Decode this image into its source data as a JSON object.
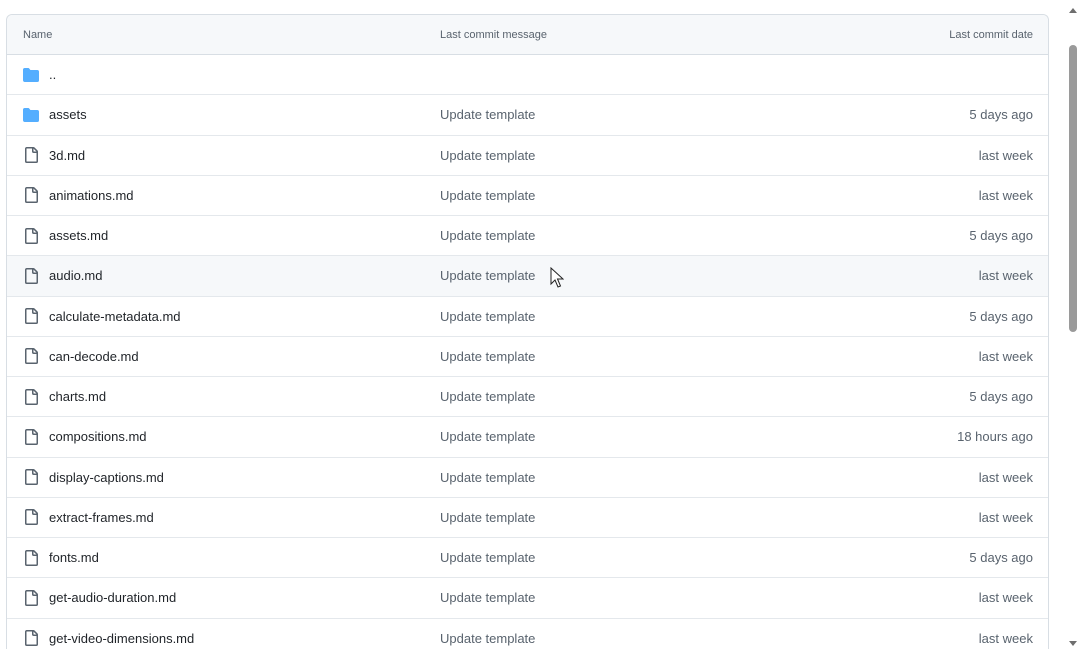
{
  "table": {
    "header": {
      "name": "Name",
      "message": "Last commit message",
      "date": "Last commit date"
    },
    "rows": [
      {
        "name": "..",
        "type": "folder",
        "message": "",
        "date": ""
      },
      {
        "name": "assets",
        "type": "folder",
        "message": "Update template",
        "date": "5 days ago"
      },
      {
        "name": "3d.md",
        "type": "file",
        "message": "Update template",
        "date": "last week"
      },
      {
        "name": "animations.md",
        "type": "file",
        "message": "Update template",
        "date": "last week"
      },
      {
        "name": "assets.md",
        "type": "file",
        "message": "Update template",
        "date": "5 days ago"
      },
      {
        "name": "audio.md",
        "type": "file",
        "message": "Update template",
        "date": "last week"
      },
      {
        "name": "calculate-metadata.md",
        "type": "file",
        "message": "Update template",
        "date": "5 days ago"
      },
      {
        "name": "can-decode.md",
        "type": "file",
        "message": "Update template",
        "date": "last week"
      },
      {
        "name": "charts.md",
        "type": "file",
        "message": "Update template",
        "date": "5 days ago"
      },
      {
        "name": "compositions.md",
        "type": "file",
        "message": "Update template",
        "date": "18 hours ago"
      },
      {
        "name": "display-captions.md",
        "type": "file",
        "message": "Update template",
        "date": "last week"
      },
      {
        "name": "extract-frames.md",
        "type": "file",
        "message": "Update template",
        "date": "last week"
      },
      {
        "name": "fonts.md",
        "type": "file",
        "message": "Update template",
        "date": "5 days ago"
      },
      {
        "name": "get-audio-duration.md",
        "type": "file",
        "message": "Update template",
        "date": "last week"
      },
      {
        "name": "get-video-dimensions.md",
        "type": "file",
        "message": "Update template",
        "date": "last week"
      }
    ]
  },
  "icons": {
    "folder": "folder-icon",
    "file": "file-icon"
  },
  "colors": {
    "folder": "#54aeff",
    "file_icon": "#59636e",
    "header_bg": "#f6f8fa",
    "border": "#d8dee4"
  }
}
